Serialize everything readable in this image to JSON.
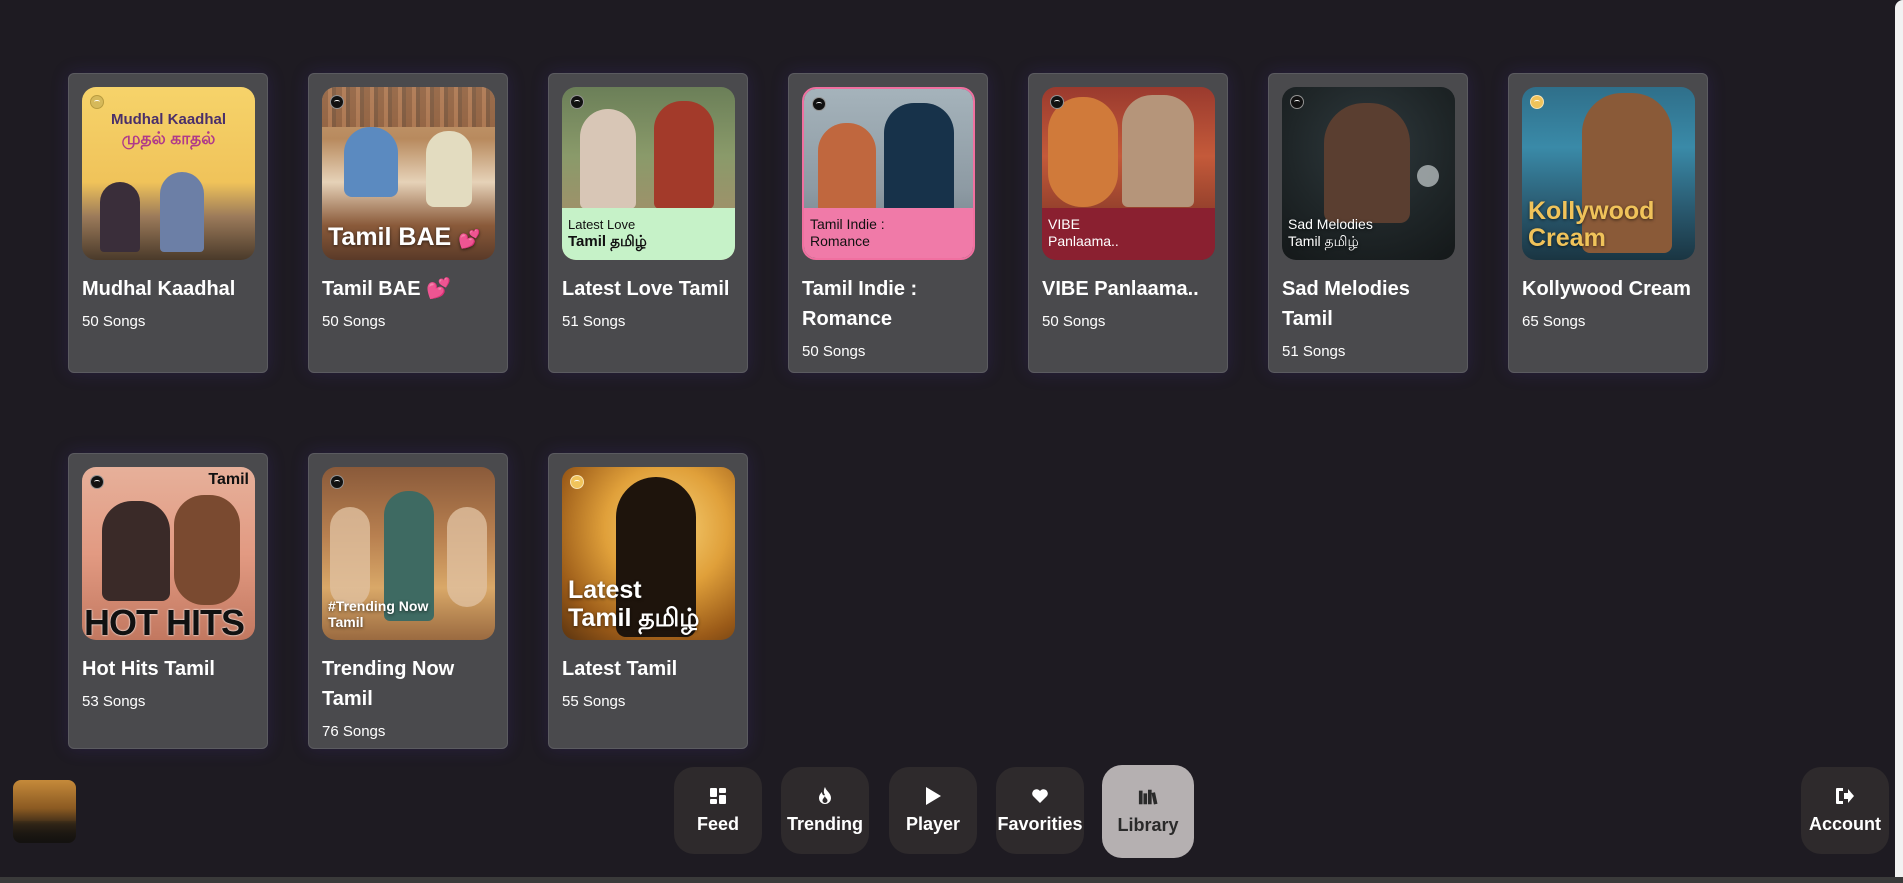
{
  "playlists": [
    {
      "title": "Mudhal Kaadhal",
      "count": "50 Songs",
      "cover_line1": "Mudhal Kaadhal",
      "cover_line2": "முதல் காதல்"
    },
    {
      "title": "Tamil BAE",
      "title_emoji": "💕",
      "count": "50 Songs",
      "cover_text": "Tamil BAE",
      "cover_emoji": "💕"
    },
    {
      "title": "Latest Love Tamil",
      "count": "51 Songs",
      "cover_line1": "Latest Love",
      "cover_line2": "Tamil தமிழ்"
    },
    {
      "title": "Tamil Indie : Romance",
      "count": "50 Songs",
      "cover_line1": "Tamil Indie :",
      "cover_line2": "Romance"
    },
    {
      "title": "VIBE Panlaama..",
      "count": "50 Songs",
      "cover_line1": "VIBE",
      "cover_line2": "Panlaama.."
    },
    {
      "title": "Sad Melodies Tamil",
      "count": "51 Songs",
      "cover_line1": "Sad Melodies",
      "cover_line2": "Tamil தமிழ்"
    },
    {
      "title": "Kollywood Cream",
      "count": "65 Songs",
      "cover_line1": "Kollywood",
      "cover_line2": "Cream"
    },
    {
      "title": "Hot Hits Tamil",
      "count": "53 Songs",
      "cover_top": "Tamil",
      "cover_text": "HOT HITS"
    },
    {
      "title": "Trending Now Tamil",
      "count": "76 Songs",
      "cover_line1": "#Trending Now",
      "cover_line2": "Tamil"
    },
    {
      "title": "Latest Tamil",
      "count": "55 Songs",
      "cover_line1": "Latest",
      "cover_line2": "Tamil தமிழ்"
    }
  ],
  "nav": {
    "feed": "Feed",
    "trending": "Trending",
    "player": "Player",
    "favorites": "Favorities",
    "library": "Library",
    "account": "Account",
    "active": "library"
  },
  "colors": {
    "background": "#1e1b22",
    "card": "#4a4a4d",
    "nav_button": "#2e2a2c",
    "nav_active": "#b5b0b1"
  }
}
